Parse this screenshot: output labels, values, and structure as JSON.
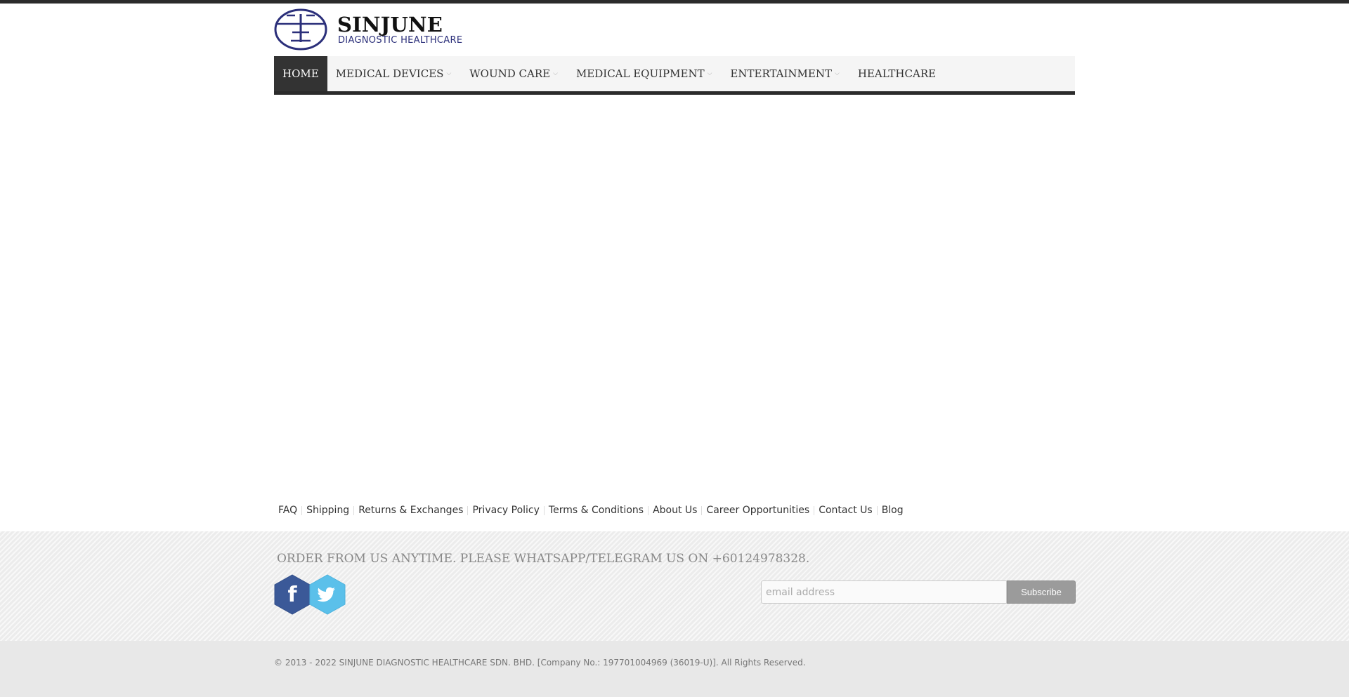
{
  "brand": {
    "name": "SINJUNE",
    "tagline": "DIAGNOSTIC HEALTHCARE",
    "logo_icon": "sinjune-logo-icon",
    "accent_color": "#2b2f7a"
  },
  "nav": {
    "items": [
      {
        "label": "HOME",
        "active": true,
        "has_dropdown": false
      },
      {
        "label": "MEDICAL DEVICES",
        "active": false,
        "has_dropdown": true
      },
      {
        "label": "WOUND CARE",
        "active": false,
        "has_dropdown": true
      },
      {
        "label": "MEDICAL EQUIPMENT",
        "active": false,
        "has_dropdown": true
      },
      {
        "label": "ENTERTAINMENT",
        "active": false,
        "has_dropdown": true
      },
      {
        "label": "HEALTHCARE",
        "active": false,
        "has_dropdown": false
      }
    ],
    "dropdown_icon": "chevron-down-icon"
  },
  "footer": {
    "links": [
      "FAQ",
      "Shipping",
      "Returns & Exchanges",
      "Privacy Policy",
      "Terms & Conditions",
      "About Us",
      "Career Opportunities",
      "Contact Us",
      "Blog"
    ],
    "order_text": "ORDER FROM US ANYTIME. PLEASE WHATSAPP/TELEGRAM US ON +60124978328.",
    "social": [
      {
        "name": "facebook-icon",
        "color": "#3b5998"
      },
      {
        "name": "twitter-icon",
        "color": "#5bc0ea"
      }
    ],
    "subscribe": {
      "placeholder": "email address",
      "value": "",
      "button_label": "Subscribe"
    },
    "copyright": "© 2013 - 2022 SINJUNE DIAGNOSTIC HEALTHCARE SDN. BHD. [Company No.: 197701004969 (36019-U)]. All Rights Reserved."
  }
}
